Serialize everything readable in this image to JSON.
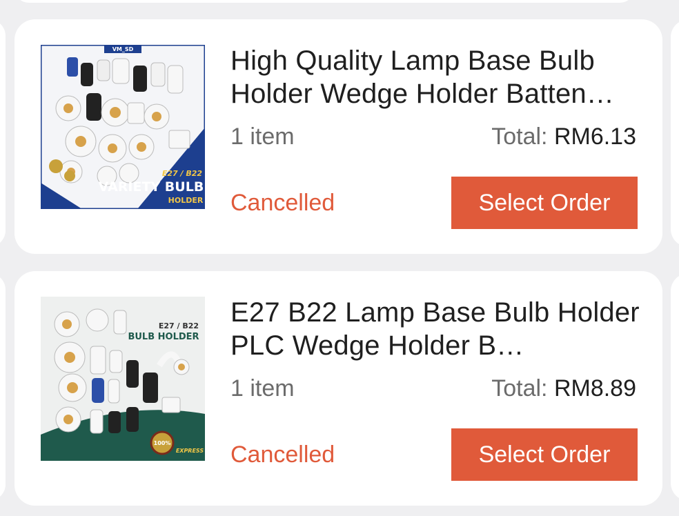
{
  "orders": [
    {
      "title": "High Quality Lamp Base Bulb Holder Wedge Holder Batten…",
      "quantity": "1 item",
      "total_label": "Total:",
      "total_value": "RM6.13",
      "status": "Cancelled",
      "action_label": "Select Order",
      "image": {
        "brand": "VM_SD",
        "spec": "E27 / B22",
        "headline": "VARIETY BULB",
        "subline": "HOLDER"
      }
    },
    {
      "title": "E27 B22 Lamp Base Bulb Holder PLC Wedge Holder B…",
      "quantity": "1 item",
      "total_label": "Total:",
      "total_value": "RM8.89",
      "status": "Cancelled",
      "action_label": "Select Order",
      "image": {
        "spec": "E27 / B22",
        "headline": "BULB HOLDER",
        "badge": "100%",
        "subline": "EXPRESS"
      }
    }
  ],
  "colors": {
    "accent": "#e05a3a",
    "background": "#efeff1",
    "card": "#ffffff",
    "muted_text": "#6b6b6b",
    "primary_text": "#1f1f1f"
  }
}
